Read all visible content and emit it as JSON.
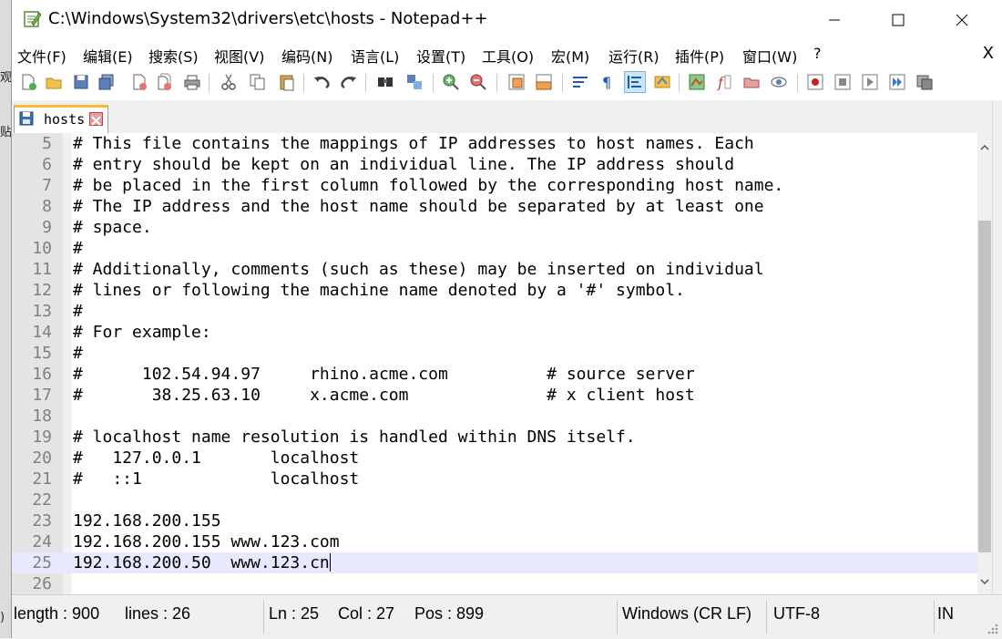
{
  "background_window": {
    "fragments": [
      "观",
      "贴",
      ")"
    ]
  },
  "window": {
    "title": "C:\\Windows\\System32\\drivers\\etc\\hosts - Notepad++",
    "controls": [
      "minimize",
      "maximize",
      "close"
    ]
  },
  "menu": {
    "items": [
      "文件(F)",
      "编辑(E)",
      "搜索(S)",
      "视图(V)",
      "编码(N)",
      "语言(L)",
      "设置(T)",
      "工具(O)",
      "宏(M)",
      "运行(R)",
      "插件(P)",
      "窗口(W)",
      "?"
    ],
    "close_label": "X"
  },
  "toolbar": {
    "icons": [
      "new-file-icon",
      "open-file-icon",
      "save-icon",
      "save-all-icon",
      "close-file-icon",
      "close-all-icon",
      "print-icon",
      "cut-icon",
      "copy-icon",
      "paste-icon",
      "undo-icon",
      "redo-icon",
      "find-icon",
      "replace-icon",
      "zoom-in-icon",
      "zoom-out-icon",
      "sync-vertical-icon",
      "sync-horizontal-icon",
      "word-wrap-icon",
      "show-all-characters-icon",
      "indent-guide-icon",
      "user-defined-language-icon",
      "document-map-icon",
      "function-list-icon",
      "folder-as-workspace-icon",
      "monitoring-icon",
      "record-macro-icon",
      "stop-recording-icon",
      "playback-macro-icon",
      "run-macro-multiple-icon",
      "save-macro-icon"
    ],
    "active_icon": "indent-guide-icon"
  },
  "tabs": [
    {
      "label": "hosts",
      "active": true
    }
  ],
  "editor": {
    "current_line": 25,
    "lines": [
      {
        "num": "5",
        "text": "# This file contains the mappings of IP addresses to host names. Each"
      },
      {
        "num": "6",
        "text": "# entry should be kept on an individual line. The IP address should"
      },
      {
        "num": "7",
        "text": "# be placed in the first column followed by the corresponding host name."
      },
      {
        "num": "8",
        "text": "# The IP address and the host name should be separated by at least one"
      },
      {
        "num": "9",
        "text": "# space."
      },
      {
        "num": "10",
        "text": "#"
      },
      {
        "num": "11",
        "text": "# Additionally, comments (such as these) may be inserted on individual"
      },
      {
        "num": "12",
        "text": "# lines or following the machine name denoted by a '#' symbol."
      },
      {
        "num": "13",
        "text": "#"
      },
      {
        "num": "14",
        "text": "# For example:"
      },
      {
        "num": "15",
        "text": "#"
      },
      {
        "num": "16",
        "text": "#      102.54.94.97     rhino.acme.com          # source server"
      },
      {
        "num": "17",
        "text": "#       38.25.63.10     x.acme.com              # x client host"
      },
      {
        "num": "18",
        "text": ""
      },
      {
        "num": "19",
        "text": "# localhost name resolution is handled within DNS itself."
      },
      {
        "num": "20",
        "text": "#   127.0.0.1       localhost"
      },
      {
        "num": "21",
        "text": "#   ::1             localhost"
      },
      {
        "num": "22",
        "text": ""
      },
      {
        "num": "23",
        "text": "192.168.200.155"
      },
      {
        "num": "24",
        "text": "192.168.200.155 www.123.com"
      },
      {
        "num": "25",
        "text": "192.168.200.50  www.123.cn"
      },
      {
        "num": "26",
        "text": ""
      }
    ]
  },
  "status": {
    "length": "length : 900",
    "lines": "lines : 26",
    "ln": "Ln : 25",
    "col": "Col : 27",
    "pos": "Pos : 899",
    "eol": "Windows (CR LF)",
    "encoding": "UTF-8",
    "mode": "IN"
  },
  "colors": {
    "current_line": "#e8e8ff",
    "gutter": "#e4e4e4",
    "line_number": "#808080",
    "tab_accent": "#f8b832"
  }
}
